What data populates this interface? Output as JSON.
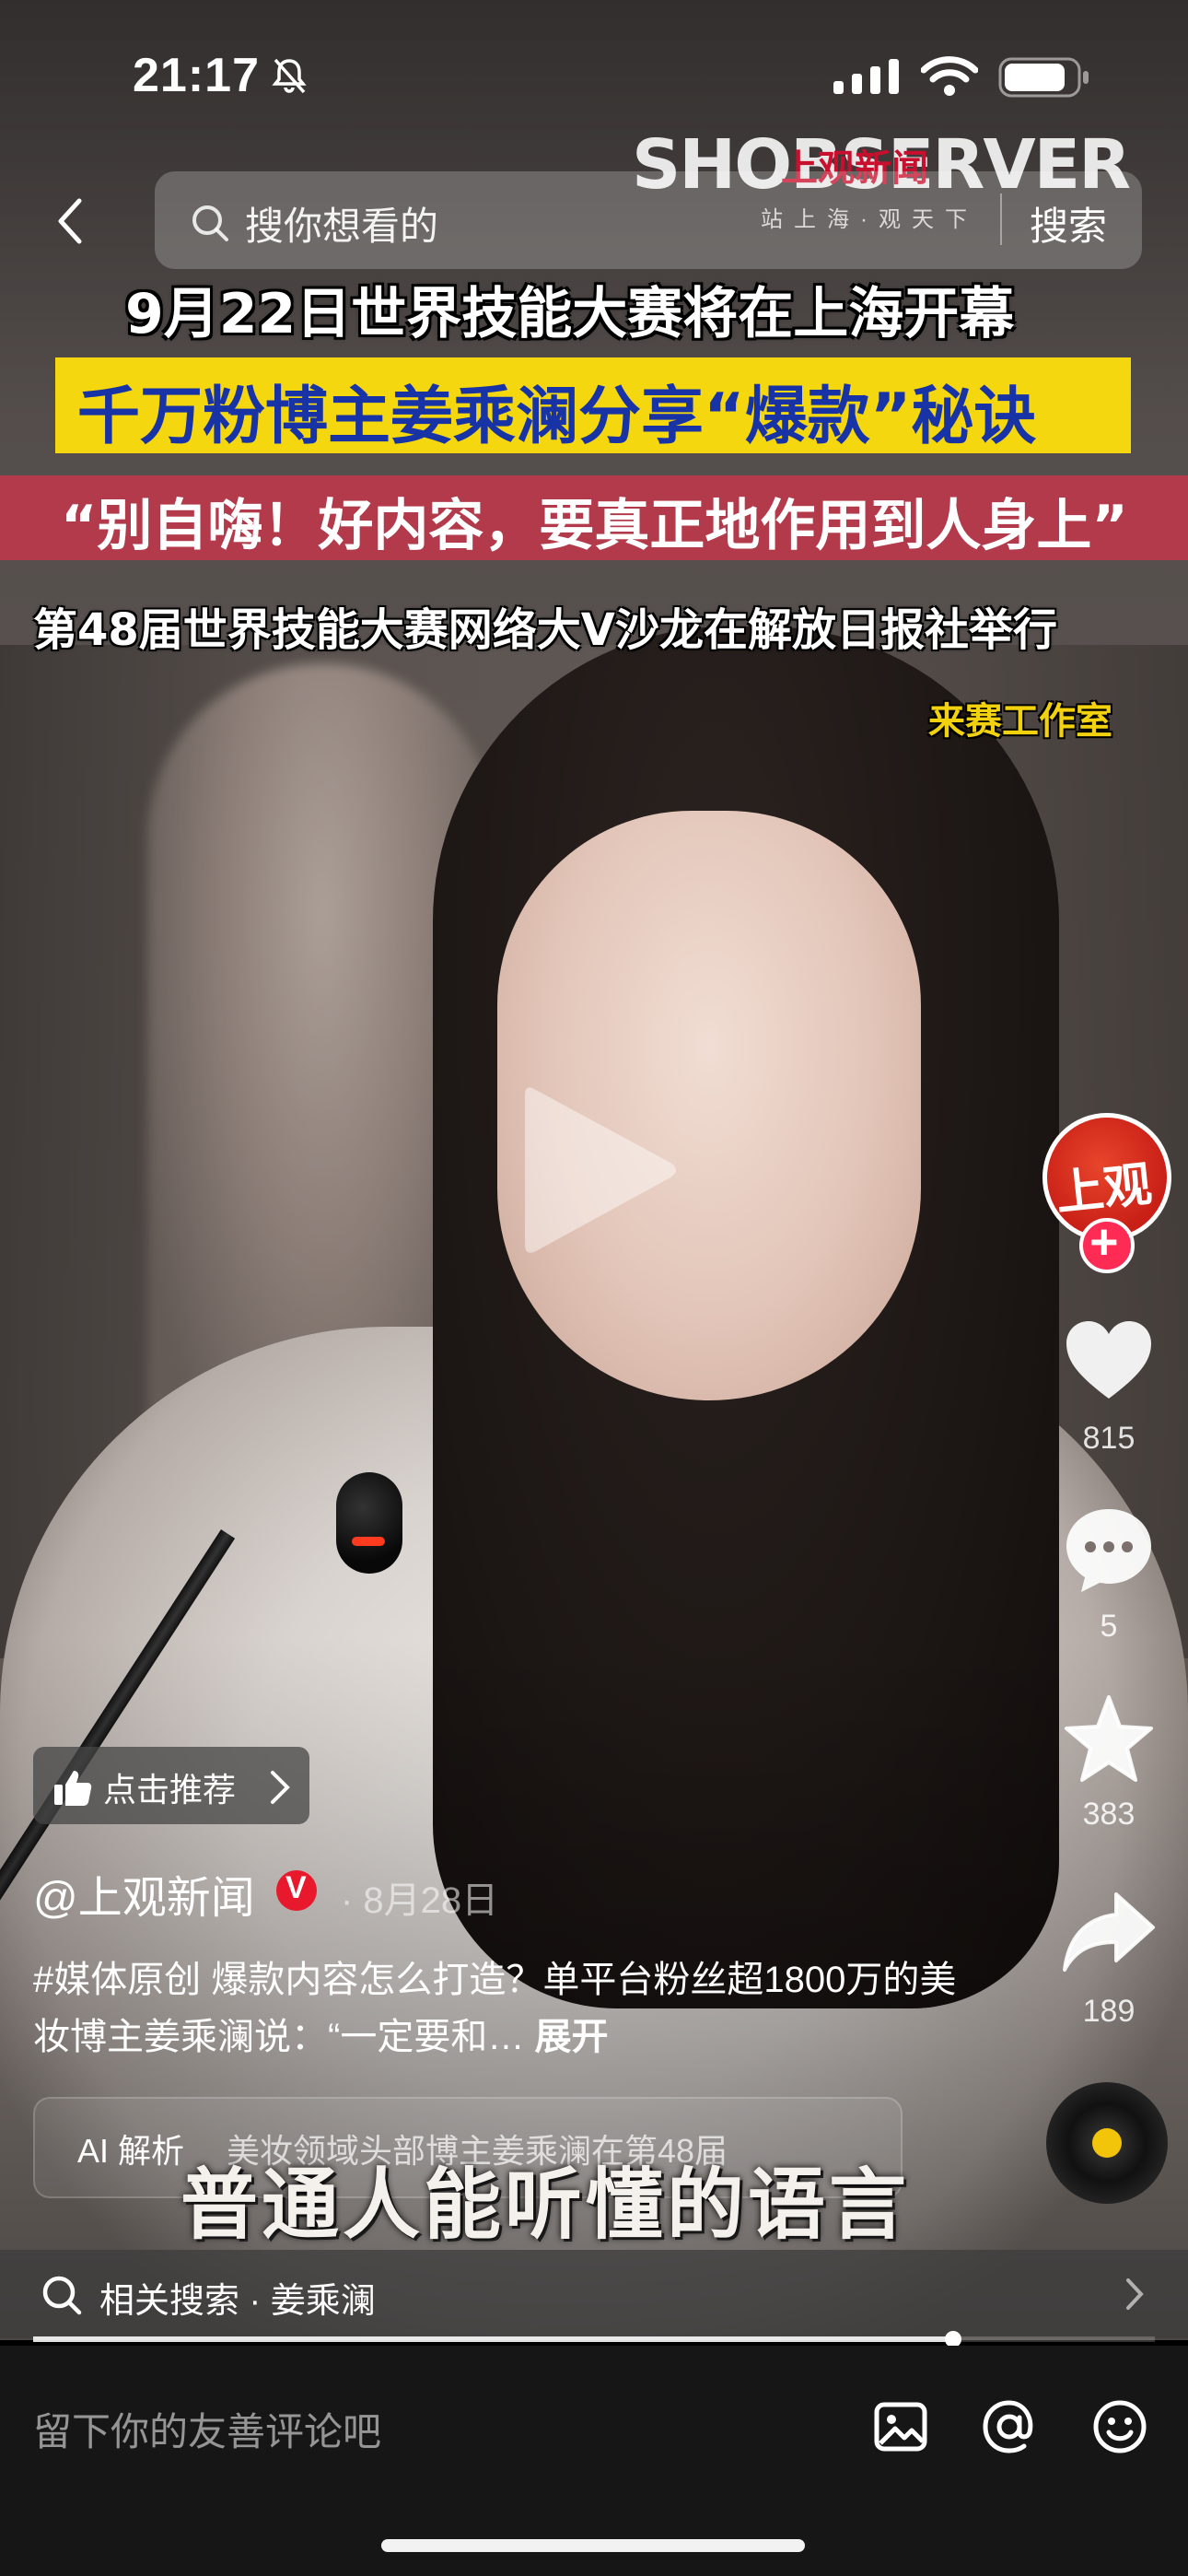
{
  "status_bar": {
    "time": "21:17",
    "battery_level": 0.85
  },
  "watermark": {
    "brand": "SHOBSERVER",
    "brand_cn": "上观新闻",
    "slogan": "站上海·观天下"
  },
  "search": {
    "placeholder": "搜你想看的",
    "button": "搜索"
  },
  "captions": {
    "line1": "9月22日世界技能大赛将在上海开幕",
    "line2": "千万粉博主姜乘澜分享“爆款”秘诀",
    "line3": "“别自嗨！好内容，要真正地作用到人身上”",
    "line4": "第48届世界技能大赛网络大V沙龙在解放日报社举行",
    "studio": "来赛工作室"
  },
  "rail": {
    "avatar_text": "上观",
    "follow": "+",
    "likes": "815",
    "comments": "5",
    "favorites": "383",
    "shares": "189"
  },
  "recommend": {
    "label": "点击推荐"
  },
  "post": {
    "author": "@上观新闻",
    "verified": "V",
    "date": "· 8月28日",
    "description": "#媒体原创 爆款内容怎么打造？单平台粉丝超1800万的美妆博主姜乘澜说：“一定要和…",
    "expand": "展开"
  },
  "ai": {
    "label": "AI 解析",
    "text": "美妆领域头部博主姜乘澜在第48届"
  },
  "subtitle": "普通人能听懂的语言",
  "related": {
    "label": "相关搜索 · 姜乘澜"
  },
  "playback": {
    "progress": 0.82
  },
  "comment": {
    "placeholder": "留下你的友善评论吧"
  },
  "colors": {
    "accent": "#fe2c55",
    "caption_yellow": "#f5d710",
    "caption_blue": "#1733a6",
    "caption_red": "#b23a4a"
  }
}
